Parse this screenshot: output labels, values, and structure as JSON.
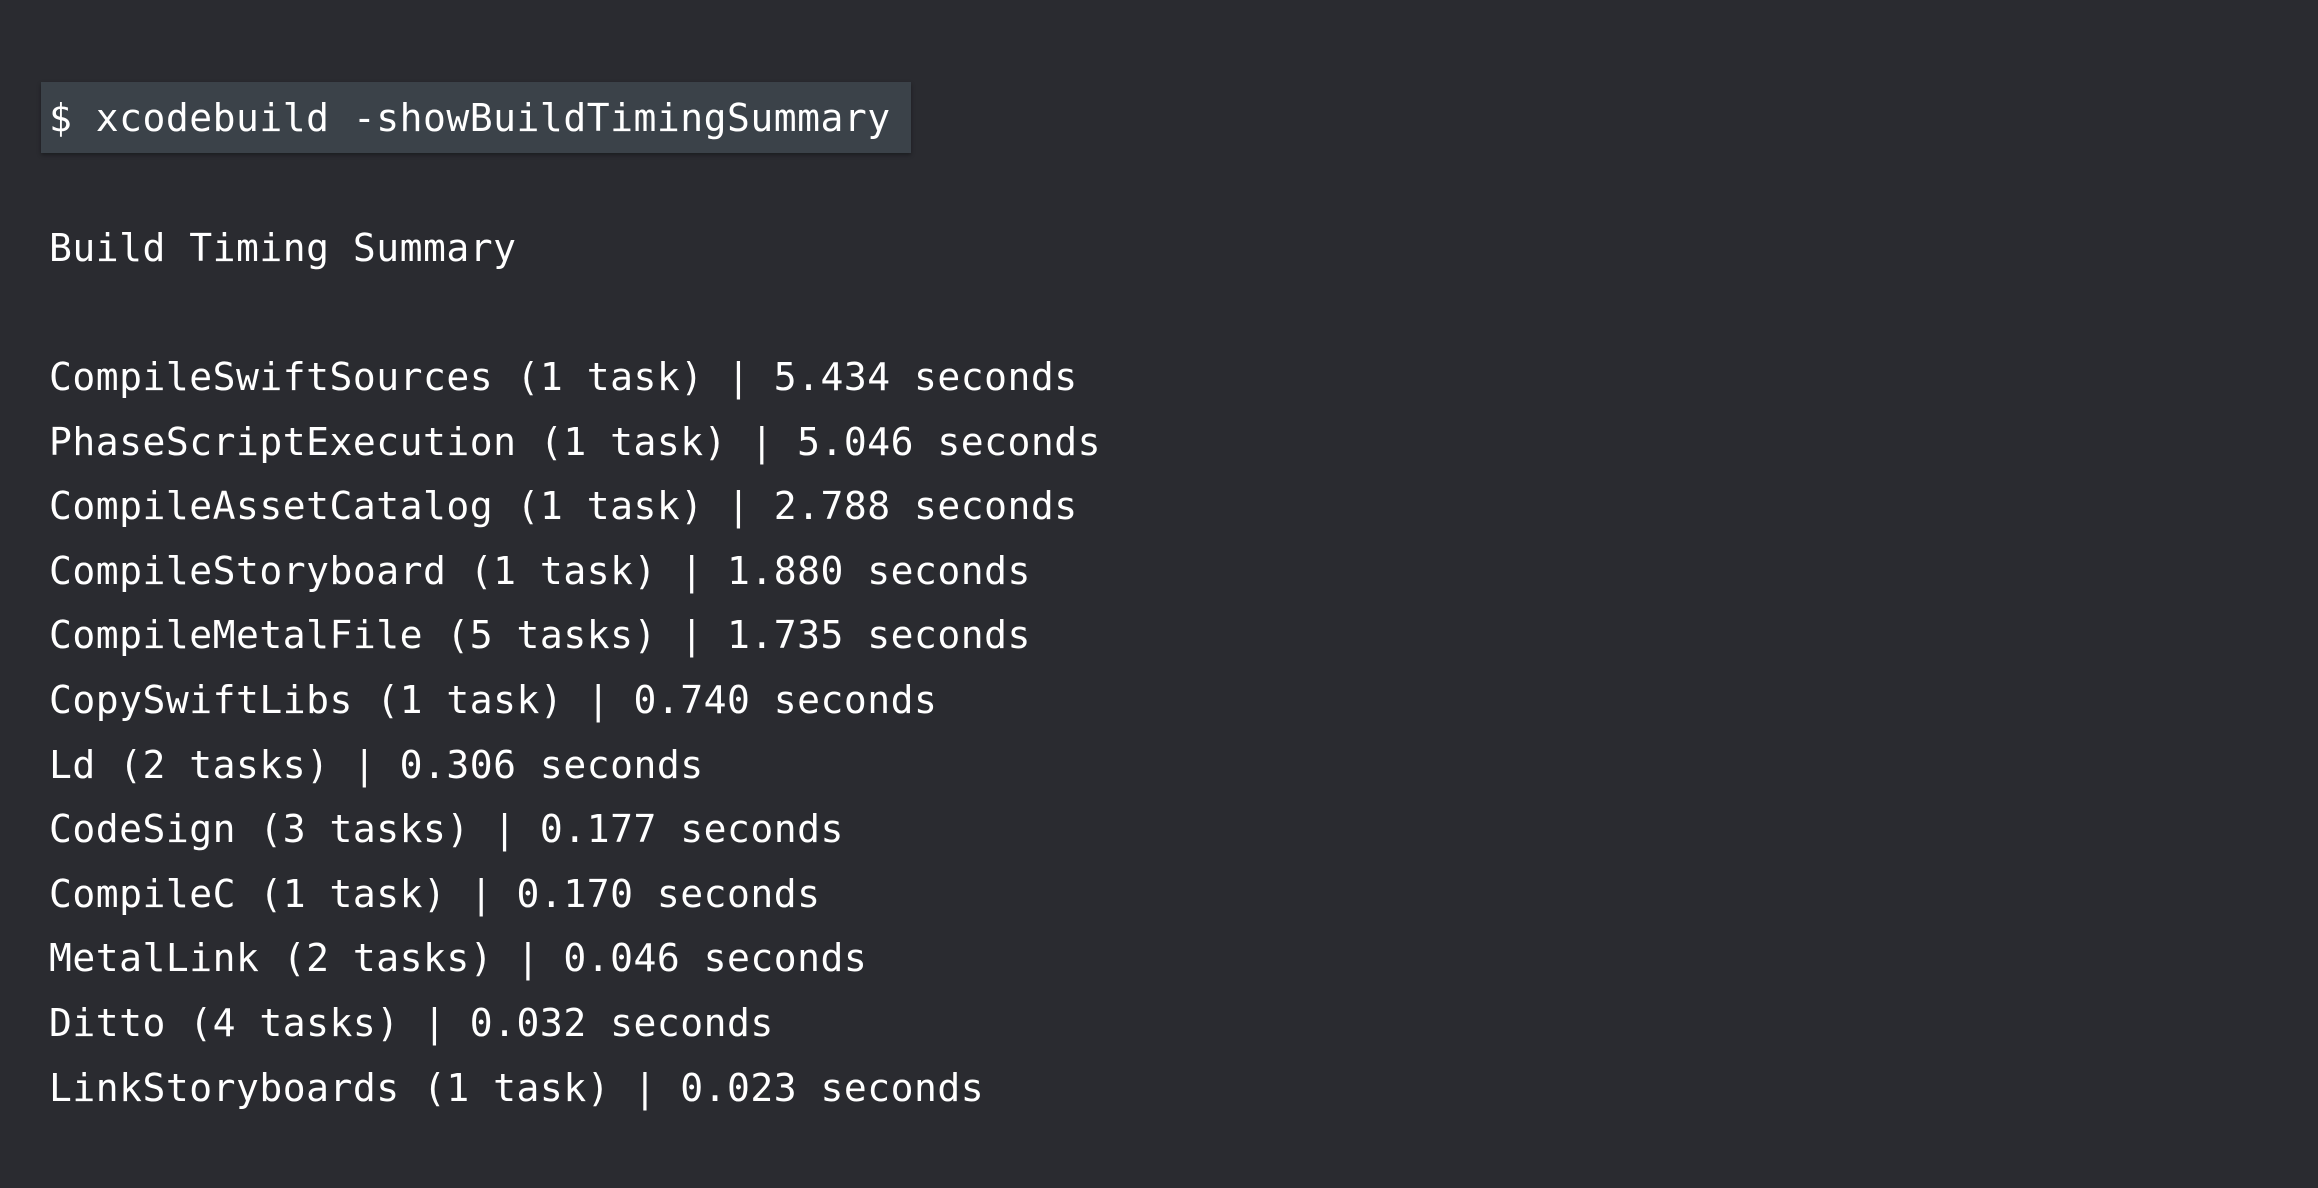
{
  "terminal": {
    "command": "$ xcodebuild -showBuildTimingSummary",
    "summary_title": "Build Timing Summary",
    "rows": [
      "CompileSwiftSources (1 task) | 5.434 seconds",
      "PhaseScriptExecution (1 task) | 5.046 seconds",
      "CompileAssetCatalog (1 task) | 2.788 seconds",
      "CompileStoryboard (1 task) | 1.880 seconds",
      "CompileMetalFile (5 tasks) | 1.735 seconds",
      "CopySwiftLibs (1 task) | 0.740 seconds",
      "Ld (2 tasks) | 0.306 seconds",
      "CodeSign (3 tasks) | 0.177 seconds",
      "CompileC (1 task) | 0.170 seconds",
      "MetalLink (2 tasks) | 0.046 seconds",
      "Ditto (4 tasks) | 0.032 seconds",
      "LinkStoryboards (1 task) | 0.023 seconds"
    ]
  },
  "colors": {
    "background": "#2a2b30",
    "command_highlight": "#3b4249",
    "text": "#ffffff"
  }
}
